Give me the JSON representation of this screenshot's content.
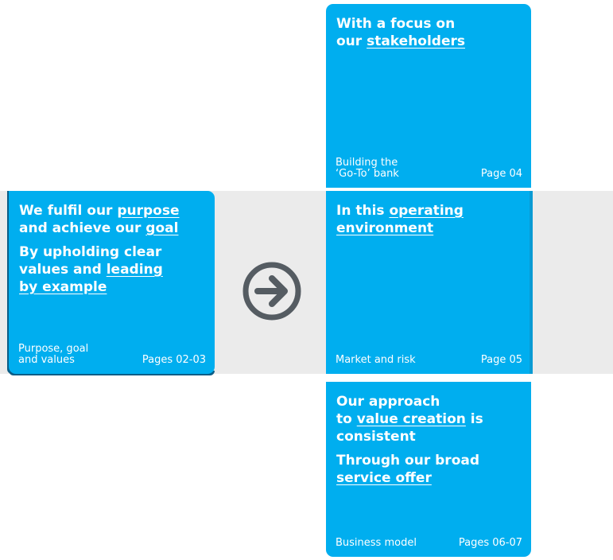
{
  "left": {
    "line1_prefix": "We fulfil our",
    "line1_link": "purpose",
    "line2_prefix": "and achieve our",
    "line2_link": "goal",
    "line3": "By upholding clear",
    "line4_prefix": "values and",
    "line4_link": "leading",
    "line5_link": "by example",
    "footer_label": "Purpose, goal\nand values",
    "footer_pages": "Pages 02-03"
  },
  "top": {
    "line1": "With a focus on",
    "line2_prefix": "our",
    "line2_link": "stakeholders",
    "footer_label": "Building the\n‘Go-To’ bank",
    "footer_pages": "Page 04"
  },
  "middle": {
    "line1_prefix": "In this",
    "line1_link": "operating",
    "line2_link": "environment",
    "footer_label": "Market and risk",
    "footer_pages": "Page 05"
  },
  "bottom": {
    "line1": "Our approach",
    "line2_prefix": "to",
    "line2_link": "value creation",
    "line2_suffix": "is",
    "line3": "consistent",
    "line4": "Through our broad",
    "line5_link": "service offer",
    "footer_label": "Business model",
    "footer_pages": "Pages 06-07"
  },
  "icons": {
    "arrow": "arrow-right-circle-icon"
  },
  "colors": {
    "tile": "#00aeef",
    "band": "#ebebeb",
    "shadow": "#0a5d86",
    "arrow": "#555c62"
  }
}
